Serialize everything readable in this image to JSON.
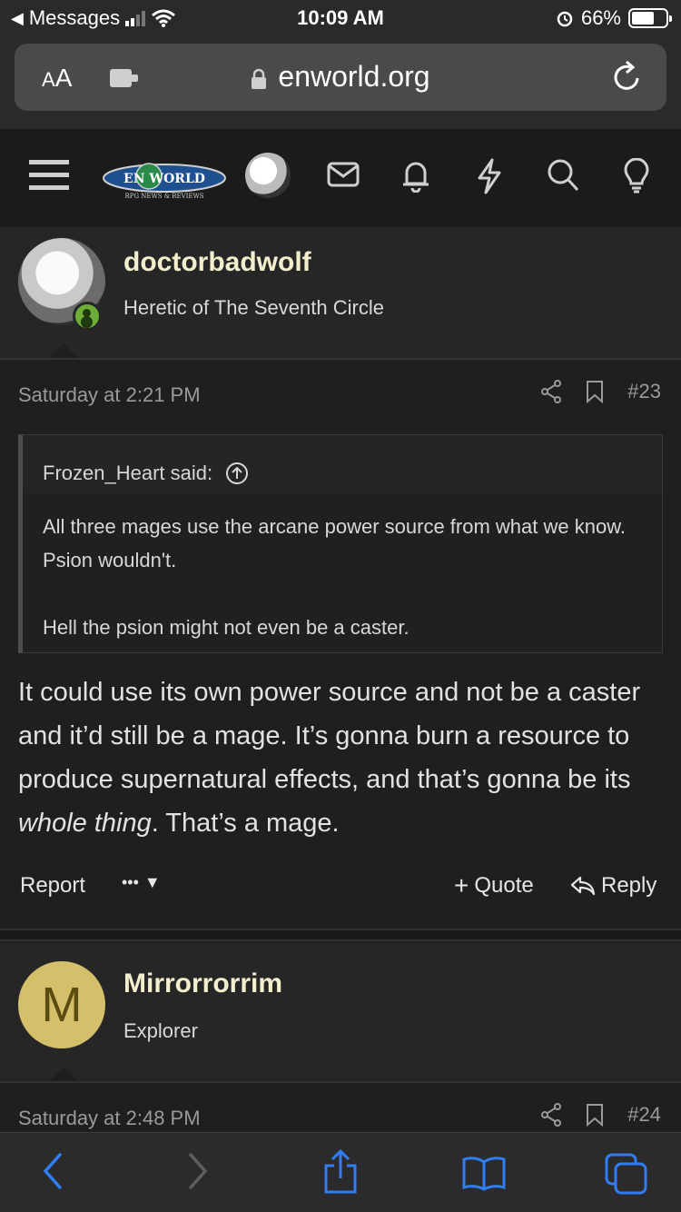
{
  "status": {
    "back_app": "Messages",
    "time": "10:09 AM",
    "battery": "66%",
    "battery_level": 0.66
  },
  "urlbar": {
    "aa_label": "AA",
    "domain": "enworld.org"
  },
  "nav": {
    "menu_icon": "hamburger-icon",
    "logo_icon": "enworld-logo",
    "icons": [
      "mail-icon",
      "bell-icon",
      "lightning-icon",
      "search-icon",
      "lightbulb-icon"
    ]
  },
  "post1": {
    "username": "doctorbadwolf",
    "user_title": "Heretic of The Seventh Circle",
    "date": "Saturday at 2:21 PM",
    "number": "#23",
    "quote_author": "Frozen_Heart said:",
    "quote_line1": "All three mages use the arcane power source from what we know. Psion wouldn't.",
    "quote_line2": "Hell the psion might not even be a caster.",
    "body_before": "It could use its own power source and not be a caster and it’d still be a mage. It’s gonna burn a resource to produce supernatural effects, and that’s gonna be its ",
    "body_em": "whole thing",
    "body_after": ". That’s a mage.",
    "report_label": "Report",
    "more_label": "•••",
    "quote_label": "Quote",
    "reply_label": "Reply"
  },
  "post2": {
    "avatar_letter": "M",
    "username": "Mirrorrorrim",
    "user_title": "Explorer",
    "date": "Saturday at 2:48 PM",
    "number": "#24"
  },
  "colors": {
    "username": "#f3efcd",
    "ios_blue": "#2f7ef5",
    "online_green": "#6cae37",
    "avatar_gold": "#d4bf6a"
  }
}
